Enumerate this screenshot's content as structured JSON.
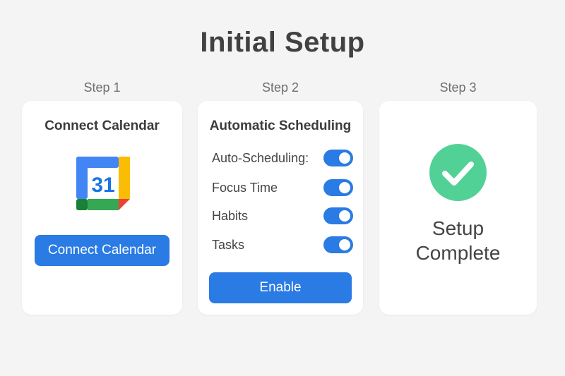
{
  "page": {
    "title": "Initial Setup"
  },
  "steps": [
    {
      "label": "Step 1",
      "heading": "Connect Calendar",
      "icon": "google-calendar-icon",
      "icon_text": "31",
      "button_label": "Connect Calendar"
    },
    {
      "label": "Step 2",
      "heading": "Automatic Scheduling",
      "toggles": [
        {
          "label": "Auto-Scheduling:",
          "on": true
        },
        {
          "label": "Focus Time",
          "on": true
        },
        {
          "label": "Habits",
          "on": true
        },
        {
          "label": "Tasks",
          "on": true
        }
      ],
      "button_label": "Enable"
    },
    {
      "label": "Step 3",
      "icon": "checkmark-circle-icon",
      "status_line1": "Setup",
      "status_line2": "Complete"
    }
  ],
  "colors": {
    "accent": "#2a7be4",
    "success": "#52d196",
    "background": "#f4f4f4",
    "card": "#ffffff"
  }
}
